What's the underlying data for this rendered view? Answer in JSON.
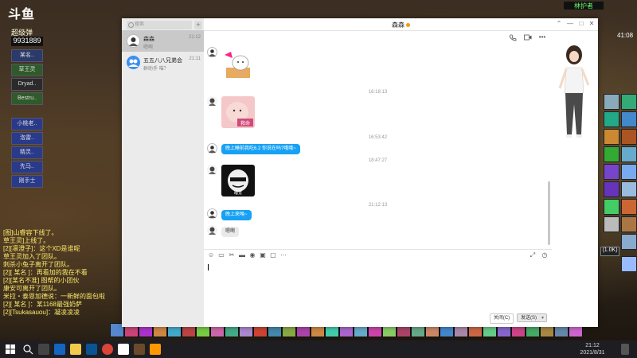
{
  "game": {
    "logo": "斗鱼",
    "stat_label": "超级弹",
    "score": "9931889",
    "raid_frames": [
      "某名..",
      "草王灵",
      "Dryad..",
      "Bestru..",
      "小桃老..",
      "洛雷..",
      "精灵..",
      "先马..",
      "刚手士"
    ],
    "top_right_label": "林护者",
    "time": "41:08",
    "tooltip": "(1.0K)",
    "chat_lines": [
      "[图]山睿容下线了。",
      "草王灵]上线了。",
      "[2][凛澄子]：这个XD是谁呢",
      "草王灵加入了团队。",
      "刺杀小兔子离开了团队。",
      "[2][ 某名 ]：再看加的我在不看",
      "[2][某名不准] 图帮的小团伙",
      "康安可离开了团队。",
      "米拉・泰恩加德说：一新鲜的面包啦",
      "[2][ 某名 ]：某1168最强奶萨",
      "[2][Tsukasauou]：凝凌凌凌"
    ]
  },
  "taskbar": {
    "time": "21:12",
    "date": "2021/8/31"
  },
  "qq": {
    "search_placeholder": "搜索",
    "add_label": "+",
    "contacts": [
      {
        "name": "森森",
        "last": "嗯啊",
        "time": "21:12"
      },
      {
        "name": "五五八八兄弟会",
        "last": "群助手 喵？",
        "time": "21:11"
      }
    ],
    "chat_title": "森森",
    "window_buttons": [
      "⌃",
      "—",
      "□",
      "✕"
    ],
    "messages": {
      "ts1": "16:18:13",
      "ts2": "16:53:42",
      "ts3": "18:47:27",
      "ts4": "21:12:13",
      "sticker_caption": "救命",
      "bubble_sent": "晚上睡前我吃6.2 你说在吗?哦哦~",
      "bubble_reply": "晚上來嗎~",
      "bubble_grey": "嗯啊",
      "meme_text": "睡觉"
    },
    "buttons": {
      "close": "关闭(C)",
      "send": "发送(S)"
    },
    "colors": {
      "bubble_blue": "#16a1f5",
      "sidebar_bg": "#ebebeb",
      "status": "#f39c12"
    }
  }
}
